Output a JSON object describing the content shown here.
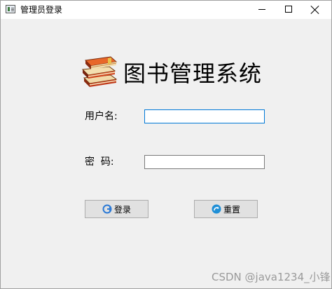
{
  "window": {
    "title": "管理员登录",
    "app_icon": "window-app-icon",
    "controls": {
      "minimize_icon": "minimize-icon",
      "maximize_icon": "maximize-icon",
      "close_icon": "close-icon"
    }
  },
  "header": {
    "icon": "books-icon",
    "title": "图书管理系统"
  },
  "form": {
    "username_label": "用户名:",
    "username_value": "",
    "password_label": "密  码:",
    "password_value": "",
    "focused_field": "username",
    "focus_color": "#0078d7"
  },
  "buttons": {
    "login_label": "登录",
    "login_icon": "login-icon",
    "reset_label": "重置",
    "reset_icon": "reset-icon"
  },
  "watermark": {
    "text": "CSDN @java1234_小锋"
  }
}
